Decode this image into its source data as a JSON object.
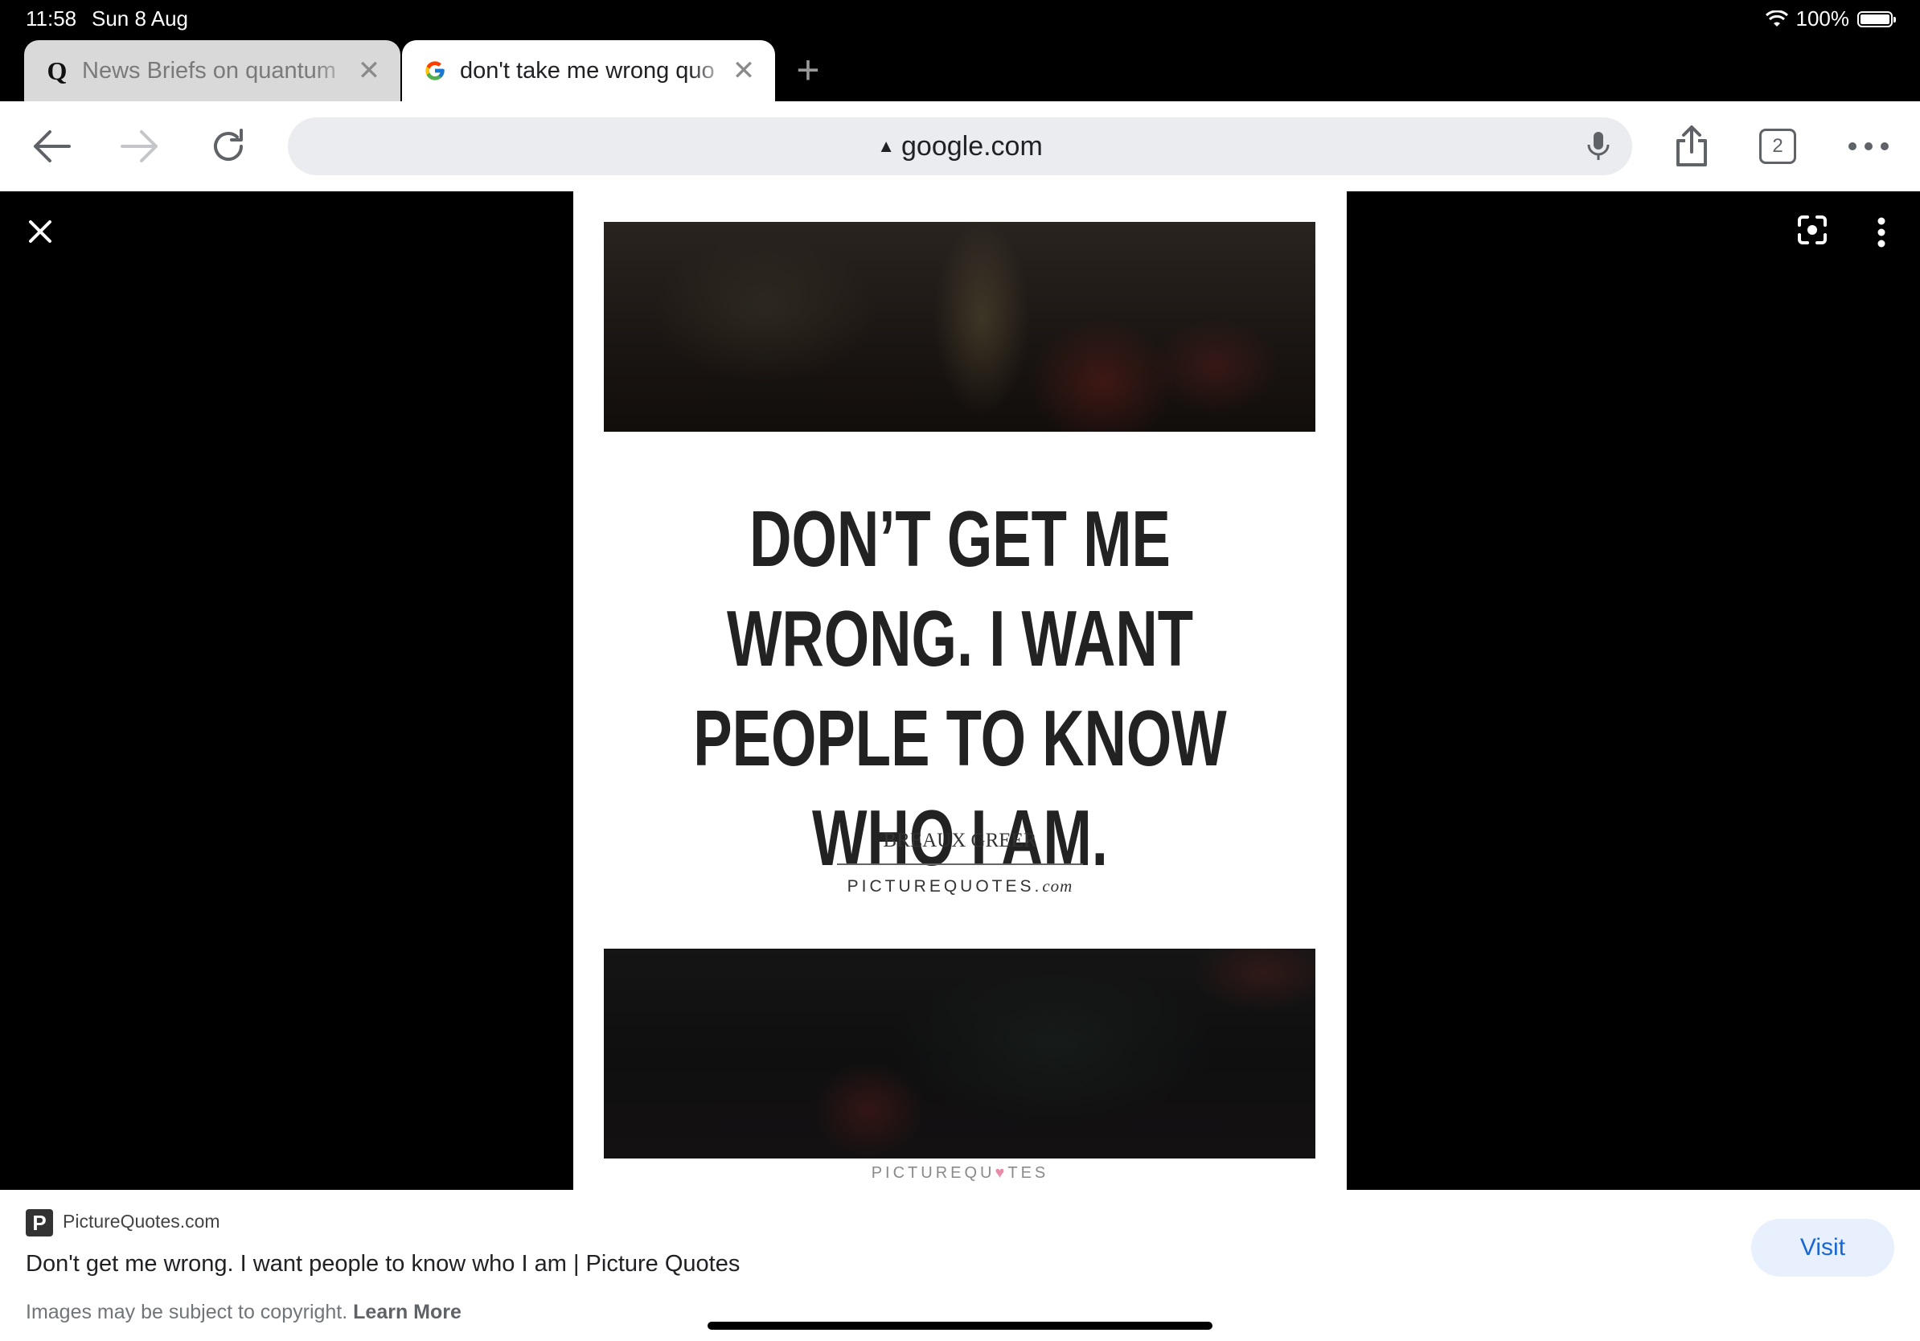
{
  "status_bar": {
    "time": "11:58",
    "date": "Sun 8 Aug",
    "battery": "100%"
  },
  "tabs": [
    {
      "title": "News Briefs on quantum",
      "favicon": "Q",
      "active": false
    },
    {
      "title": "don't take me wrong quo",
      "favicon": "G",
      "active": true
    }
  ],
  "toolbar": {
    "url": "google.com",
    "tab_count": "2"
  },
  "quote_image": {
    "quote": "DON’T GET ME WRONG. I WANT PEOPLE TO KNOW WHO I AM.",
    "author": "BREAUX GREER",
    "site": "PICTUREQUOTES.",
    "site_suffix": "com",
    "watermark_left": "PICTUREQU",
    "watermark_right": "TES"
  },
  "info": {
    "source": "PictureQuotes.com",
    "title": "Don't get me wrong. I want people to know who I am | Picture Quotes",
    "copyright": "Images may be subject to copyright.",
    "learn_more": "Learn More",
    "visit_label": "Visit"
  },
  "colors": {
    "accent": "#1967d2",
    "visit_bg": "#e8f0fe",
    "heart": "#e88aa8"
  }
}
